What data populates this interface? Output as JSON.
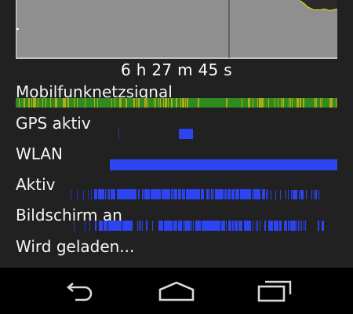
{
  "status": {
    "duration": "6 h 27 m 45 s"
  },
  "colors": {
    "chart_fill": "#8f8f8f",
    "chart_line": "#e8e800",
    "signal_green": "#2f8a1f",
    "signal_yellow": "#b3aa17",
    "active_blue": "#2d44f2",
    "thin_blue": "#2537d0"
  },
  "battery_chart": {
    "charge_percent_end": [
      96,
      96,
      98,
      98
    ],
    "charge_percent_start": 100
  },
  "rows": [
    {
      "label": "Mobilfunknetzsignal",
      "icon": "signal-bar"
    },
    {
      "label": "GPS aktiv",
      "icon": "gps-bar"
    },
    {
      "label": "WLAN",
      "icon": "wlan-bar"
    },
    {
      "label": "Aktiv",
      "icon": "awake-bar"
    },
    {
      "label": "Bildschirm an",
      "icon": "screen-bar"
    },
    {
      "label": "Wird geladen...",
      "icon": "charging-bar"
    }
  ],
  "navbar": {
    "back": "back-icon",
    "home": "home-icon",
    "recents": "recents-icon"
  }
}
